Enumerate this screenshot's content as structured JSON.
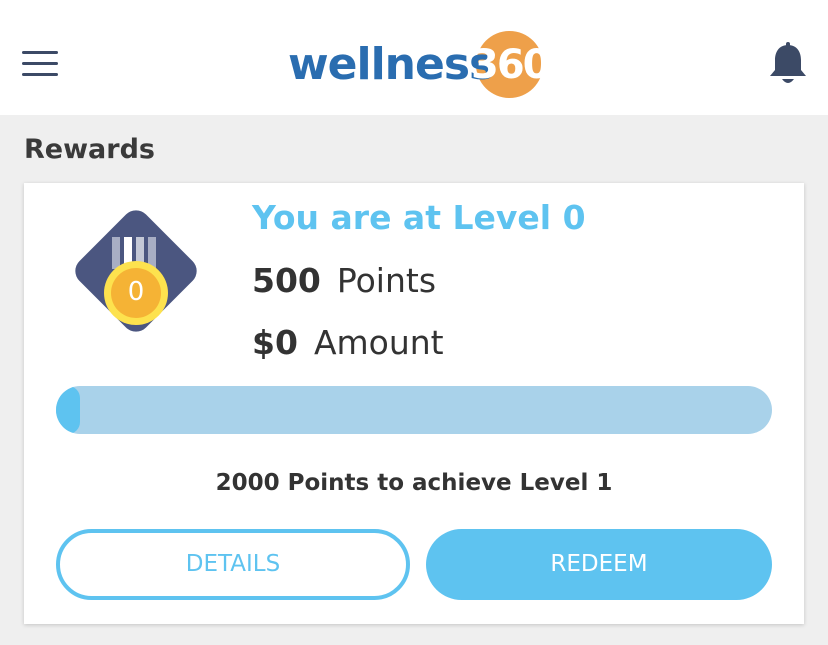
{
  "header": {
    "logo_word": "wellness",
    "logo_number": "360",
    "menu_icon": "hamburger-menu-icon",
    "notification_icon": "bell-icon"
  },
  "page": {
    "title": "Rewards"
  },
  "rewards": {
    "badge_level": "0",
    "level_title": "You are at Level 0",
    "points_value": "500",
    "points_label": "Points",
    "amount_value": "$0",
    "amount_label": "Amount",
    "progress_fraction": 0.02,
    "next_level_text": "2000 Points to achieve Level 1",
    "details_label": "DETAILS",
    "redeem_label": "REDEEM"
  },
  "colors": {
    "accent": "#5ec3f0",
    "progress_track": "#a9d2ea",
    "logo_blue": "#2a6db0",
    "logo_orange": "#eea04a",
    "badge_navy": "#4b5680",
    "medal_gold": "#f5b335",
    "medal_rim": "#fde24e"
  }
}
